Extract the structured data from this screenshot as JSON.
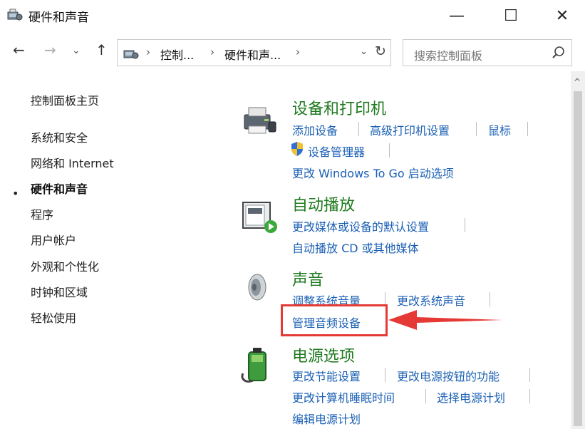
{
  "window": {
    "title": "硬件和声音",
    "controls": {
      "minimize": "—",
      "maximize": "☐",
      "close": "✕"
    }
  },
  "nav": {
    "back": "←",
    "forward": "→",
    "recent": "⌄",
    "up": "↑",
    "breadcrumbs": [
      "控制...",
      "硬件和声..."
    ],
    "separator": "›",
    "dropdown": "⌄",
    "refresh": "↻",
    "search_placeholder": "搜索控制面板"
  },
  "sidebar": {
    "bullet": "•",
    "items": [
      {
        "label": "控制面板主页",
        "active": false
      },
      {
        "label": "系统和安全",
        "active": false
      },
      {
        "label": "网络和 Internet",
        "active": false
      },
      {
        "label": "硬件和声音",
        "active": true
      },
      {
        "label": "程序",
        "active": false
      },
      {
        "label": "用户帐户",
        "active": false
      },
      {
        "label": "外观和个性化",
        "active": false
      },
      {
        "label": "时钟和区域",
        "active": false
      },
      {
        "label": "轻松使用",
        "active": false
      }
    ]
  },
  "sections": {
    "devices": {
      "title": "设备和打印机",
      "icon": "printer-icon",
      "links": [
        "添加设备",
        "高级打印机设置",
        "鼠标",
        "设备管理器",
        "更改 Windows To Go 启动选项"
      ]
    },
    "autoplay": {
      "title": "自动播放",
      "icon": "autoplay-icon",
      "links": [
        "更改媒体或设备的默认设置",
        "自动播放 CD 或其他媒体"
      ]
    },
    "sound": {
      "title": "声音",
      "icon": "speaker-icon",
      "links": [
        "调整系统音量",
        "更改系统声音",
        "管理音频设备"
      ]
    },
    "power": {
      "title": "电源选项",
      "icon": "battery-icon",
      "links": [
        "更改节能设置",
        "更改电源按钮的功能",
        "更改计算机睡眠时间",
        "选择电源计划",
        "编辑电源计划"
      ]
    }
  },
  "scrollbar": {
    "up": "^"
  },
  "colors": {
    "link": "#1a5fb4",
    "title": "#1f7a1f",
    "highlight": "#e53935"
  }
}
